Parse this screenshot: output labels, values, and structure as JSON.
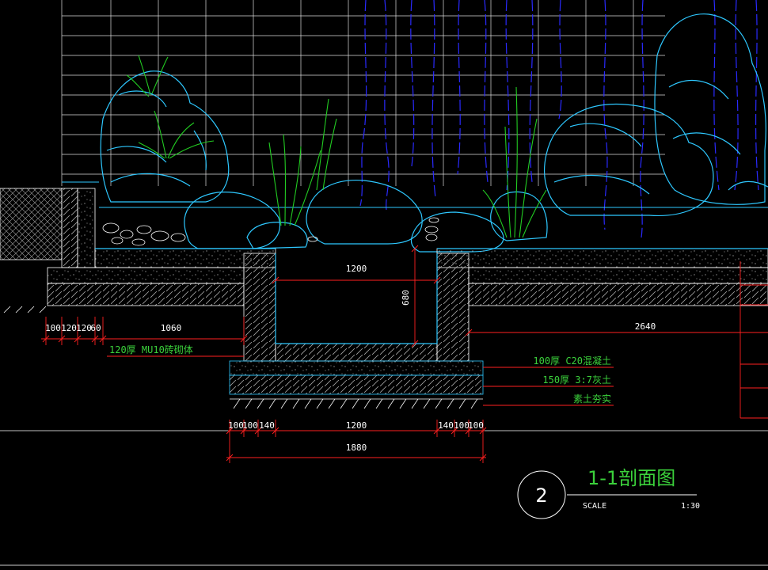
{
  "drawing": {
    "title": "1-1剖面图",
    "detail_number": "2",
    "scale_label": "SCALE",
    "scale_value": "1:30"
  },
  "dimensions": {
    "channel_inner_width": "1200",
    "channel_depth": "680",
    "left_chain": [
      "100",
      "120",
      "120",
      "60",
      "1060"
    ],
    "right_width": "2640",
    "bottom_chain": [
      "100",
      "100",
      "140",
      "1200",
      "140",
      "100",
      "100"
    ],
    "bottom_total": "1880"
  },
  "notes": {
    "left_wall": "120厚 MU10砖砌体",
    "concrete": "100厚 C20混凝土",
    "lime_soil": "150厚 3:7灰土",
    "subgrade": "素土夯实"
  },
  "colors": {
    "background": "#000000",
    "dimension_line": "#ff2020",
    "text": "#ffffff",
    "annotation": "#3bd13b",
    "rock": "#2ec8ff",
    "water": "#2222ff",
    "plant": "#22cc22"
  }
}
